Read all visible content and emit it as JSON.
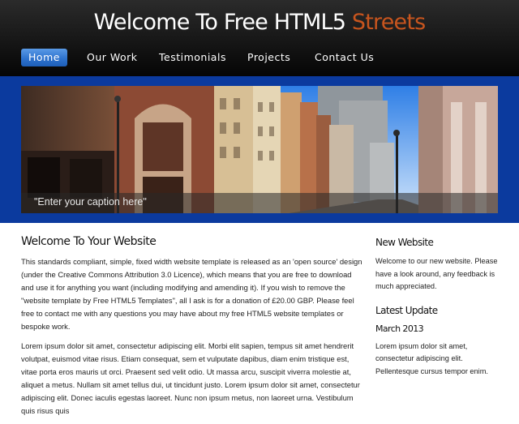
{
  "header": {
    "title_main": "Welcome To Free HTML5 ",
    "title_accent": "Streets",
    "accent_color": "#c8551e"
  },
  "menu": {
    "items": [
      {
        "label": "Home",
        "selected": true
      },
      {
        "label": "Our Work",
        "selected": false
      },
      {
        "label": "Testimonials",
        "selected": false
      },
      {
        "label": "Projects",
        "selected": false
      },
      {
        "label": "Contact Us",
        "selected": false
      }
    ],
    "selected_color": "#2f74cf"
  },
  "banner": {
    "background_color": "#0b3a9e",
    "image": "street-photo",
    "caption": "\"Enter your caption here\""
  },
  "main": {
    "heading": "Welcome To Your Website",
    "paragraphs": [
      "This standards compliant, simple, fixed width website template is released as an 'open source' design (under the Creative Commons Attribution 3.0 Licence), which means that you are free to download and use it for anything you want (including modifying and amending it). If you wish to remove the \"website template by Free HTML5 Templates\", all I ask is for a donation of £20.00 GBP. Please feel free to contact me with any questions you may have about my free HTML5 website templates or bespoke work.",
      "Lorem ipsum dolor sit amet, consectetur adipiscing elit. Morbi elit sapien, tempus sit amet hendrerit volutpat, euismod vitae risus. Etiam consequat, sem et vulputate dapibus, diam enim tristique est, vitae porta eros mauris ut orci. Praesent sed velit odio. Ut massa arcu, suscipit viverra molestie at, aliquet a metus. Nullam sit amet tellus dui, ut tincidunt justo. Lorem ipsum dolor sit amet, consectetur adipiscing elit. Donec iaculis egestas laoreet. Nunc non ipsum metus, non laoreet urna. Vestibulum quis risus quis"
    ]
  },
  "sidebar": {
    "new_website_heading": "New Website",
    "new_website_text": "Welcome to our new website. Please have a look around, any feedback is much appreciated.",
    "latest_update_heading": "Latest Update",
    "latest_update_date": "March 2013",
    "latest_update_text": "Lorem ipsum dolor sit amet, consectetur adipiscing elit. Pellentesque cursus tempor enim."
  }
}
